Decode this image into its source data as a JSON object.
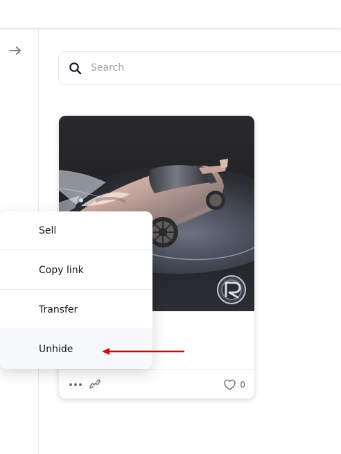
{
  "colors": {
    "page_background": "#ffffff",
    "border": "#e6e8ee",
    "text_primary": "#111827",
    "text_muted": "#9aa0aa",
    "icon_gray": "#6b7280",
    "annotation_red": "#e00000"
  },
  "sidebar": {
    "collapse_toggle_icon": "arrow-right-icon"
  },
  "search": {
    "icon": "search-icon",
    "placeholder": "Search",
    "value": ""
  },
  "nft_card": {
    "image_icon": "car-image",
    "badge_icon": "r-badge-icon",
    "actions": {
      "more_icon": "more-horizontal-icon",
      "link_icon": "link-icon"
    },
    "likes": {
      "icon": "heart-icon",
      "count": "0"
    }
  },
  "context_menu": {
    "items": [
      {
        "label": "Sell"
      },
      {
        "label": "Copy link"
      },
      {
        "label": "Transfer"
      },
      {
        "label": "Unhide"
      }
    ],
    "active_item": "Unhide"
  },
  "annotation": {
    "icon": "red-arrow-icon",
    "color": "#e00000"
  }
}
